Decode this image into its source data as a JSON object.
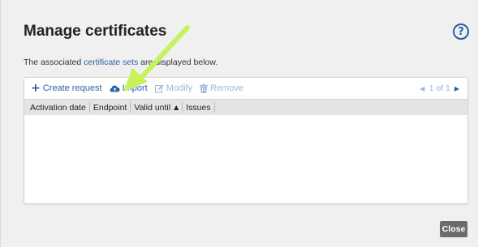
{
  "dialog": {
    "title": "Manage certificates",
    "help_icon": "question-circle-icon",
    "description_prefix": "The associated ",
    "description_link": "certificate sets",
    "description_suffix": " are displayed below."
  },
  "toolbar": {
    "create_request_label": "Create request",
    "import_label": "Import",
    "modify_label": "Modify",
    "remove_label": "Remove",
    "pager_text": "1 of 1"
  },
  "table": {
    "columns": [
      "Activation date",
      "Endpoint",
      "Valid until",
      "Issues"
    ],
    "sorted_column": "Valid until",
    "rows": []
  },
  "footer": {
    "close_label": "Close"
  },
  "colors": {
    "accent": "#2b5ea7",
    "disabled": "#9bb6d8",
    "annotation_arrow": "#c6f25a"
  }
}
